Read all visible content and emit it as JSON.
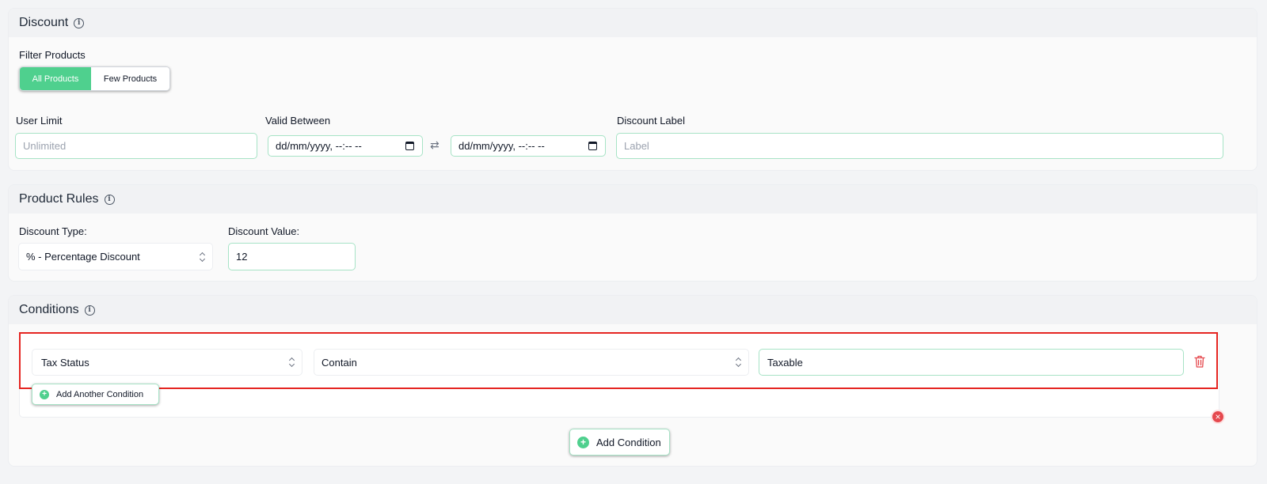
{
  "discount": {
    "title": "Discount",
    "filter_label": "Filter Products",
    "filter_options": [
      "All Products",
      "Few Products"
    ],
    "user_limit_label": "User Limit",
    "user_limit_placeholder": "Unlimited",
    "valid_between_label": "Valid Between",
    "date_start": "dd/mm/yyyy, --:-- --",
    "date_end": "dd/mm/yyyy, --:-- --",
    "label_label": "Discount Label",
    "label_placeholder": "Label"
  },
  "product_rules": {
    "title": "Product Rules",
    "type_label": "Discount Type:",
    "type_value": "% - Percentage Discount",
    "value_label": "Discount Value:",
    "value_value": "12"
  },
  "conditions": {
    "title": "Conditions",
    "rows": [
      {
        "field": "Tax Status",
        "operator": "Contain",
        "value": "Taxable"
      }
    ],
    "add_another_label": "Add Another Condition",
    "add_condition_label": "Add Condition"
  },
  "icons": {
    "info": "info-icon",
    "calendar": "calendar-icon",
    "swap": "swap-icon",
    "trash": "trash-icon",
    "plus": "plus-circle-icon",
    "close": "close-circle-icon"
  },
  "colors": {
    "accent": "#4fd08e",
    "border_accent": "#a7e3c6",
    "highlight": "#e52521",
    "danger": "#e5484d"
  }
}
